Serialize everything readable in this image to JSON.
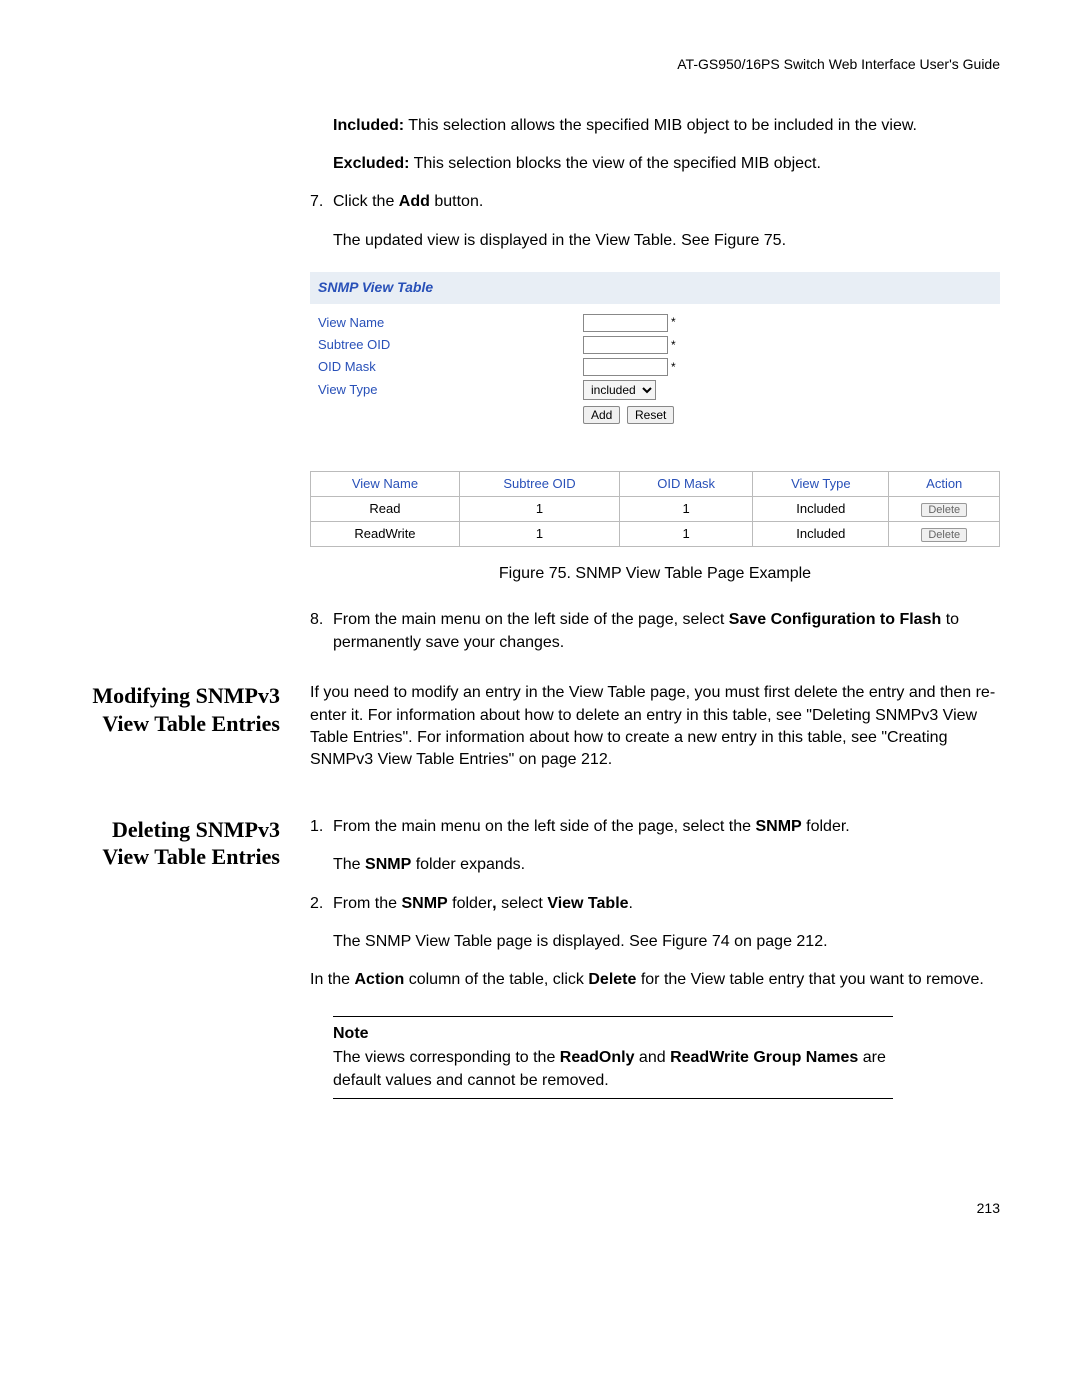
{
  "header": "AT-GS950/16PS Switch Web Interface User's Guide",
  "intro": {
    "included_label": "Included:",
    "included_text": " This selection allows the specified MIB object to be included in the view.",
    "excluded_label": "Excluded:",
    "excluded_text": " This selection blocks the view of the specified MIB object."
  },
  "step7": {
    "num": "7.",
    "p1a": "Click the ",
    "p1b": "Add",
    "p1c": " button.",
    "p2": "The updated view is displayed in the View Table. See Figure 75."
  },
  "snmp": {
    "title": "SNMP View Table",
    "labels": {
      "view_name": "View Name",
      "subtree_oid": "Subtree OID",
      "oid_mask": "OID Mask",
      "view_type": "View Type"
    },
    "select_value": "included",
    "add_btn": "Add",
    "reset_btn": "Reset",
    "table": {
      "headers": [
        "View Name",
        "Subtree OID",
        "OID Mask",
        "View Type",
        "Action"
      ],
      "rows": [
        [
          "Read",
          "1",
          "1",
          "Included",
          "Delete"
        ],
        [
          "ReadWrite",
          "1",
          "1",
          "Included",
          "Delete"
        ]
      ]
    }
  },
  "figure_caption": "Figure 75. SNMP View Table Page Example",
  "step8": {
    "num": "8.",
    "t1": "From the main menu on the left side of the page, select ",
    "b1": "Save Configuration to Flash",
    "t2": " to permanently save your changes."
  },
  "modifying": {
    "heading": "Modifying SNMPv3 View Table Entries",
    "body": "If you need to modify an entry in the View Table page, you must first delete the entry and then re-enter it. For information about how to delete an entry in this table, see \"Deleting SNMPv3 View Table Entries\". For information about how to create a new entry in this table, see \"Creating SNMPv3 View Table Entries\" on page 212."
  },
  "deleting": {
    "heading": "Deleting SNMPv3 View Table Entries",
    "s1": {
      "num": "1.",
      "t1": "From the main menu on the left side of the page, select the ",
      "b1": "SNMP",
      "t2": " folder.",
      "p2a": "The ",
      "p2b": "SNMP",
      "p2c": " folder expands."
    },
    "s2": {
      "num": "2.",
      "t1": "From the ",
      "b1": "SNMP",
      "t2": " folder",
      "b2": ",",
      "t3": " select ",
      "b3": "View Table",
      "t4": ".",
      "p2": "The SNMP View Table page is displayed. See Figure 74 on page 212."
    },
    "action_para_a": "In the ",
    "action_para_b": "Action",
    "action_para_c": " column of the table, click ",
    "action_para_d": "Delete",
    "action_para_e": " for the View table entry that you want to remove.",
    "note_title": "Note",
    "note_a": "The views corresponding to the ",
    "note_b": "ReadOnly",
    "note_c": " and ",
    "note_d": "ReadWrite Group Names",
    "note_e": " are default values and cannot be removed."
  },
  "page_number": "213"
}
